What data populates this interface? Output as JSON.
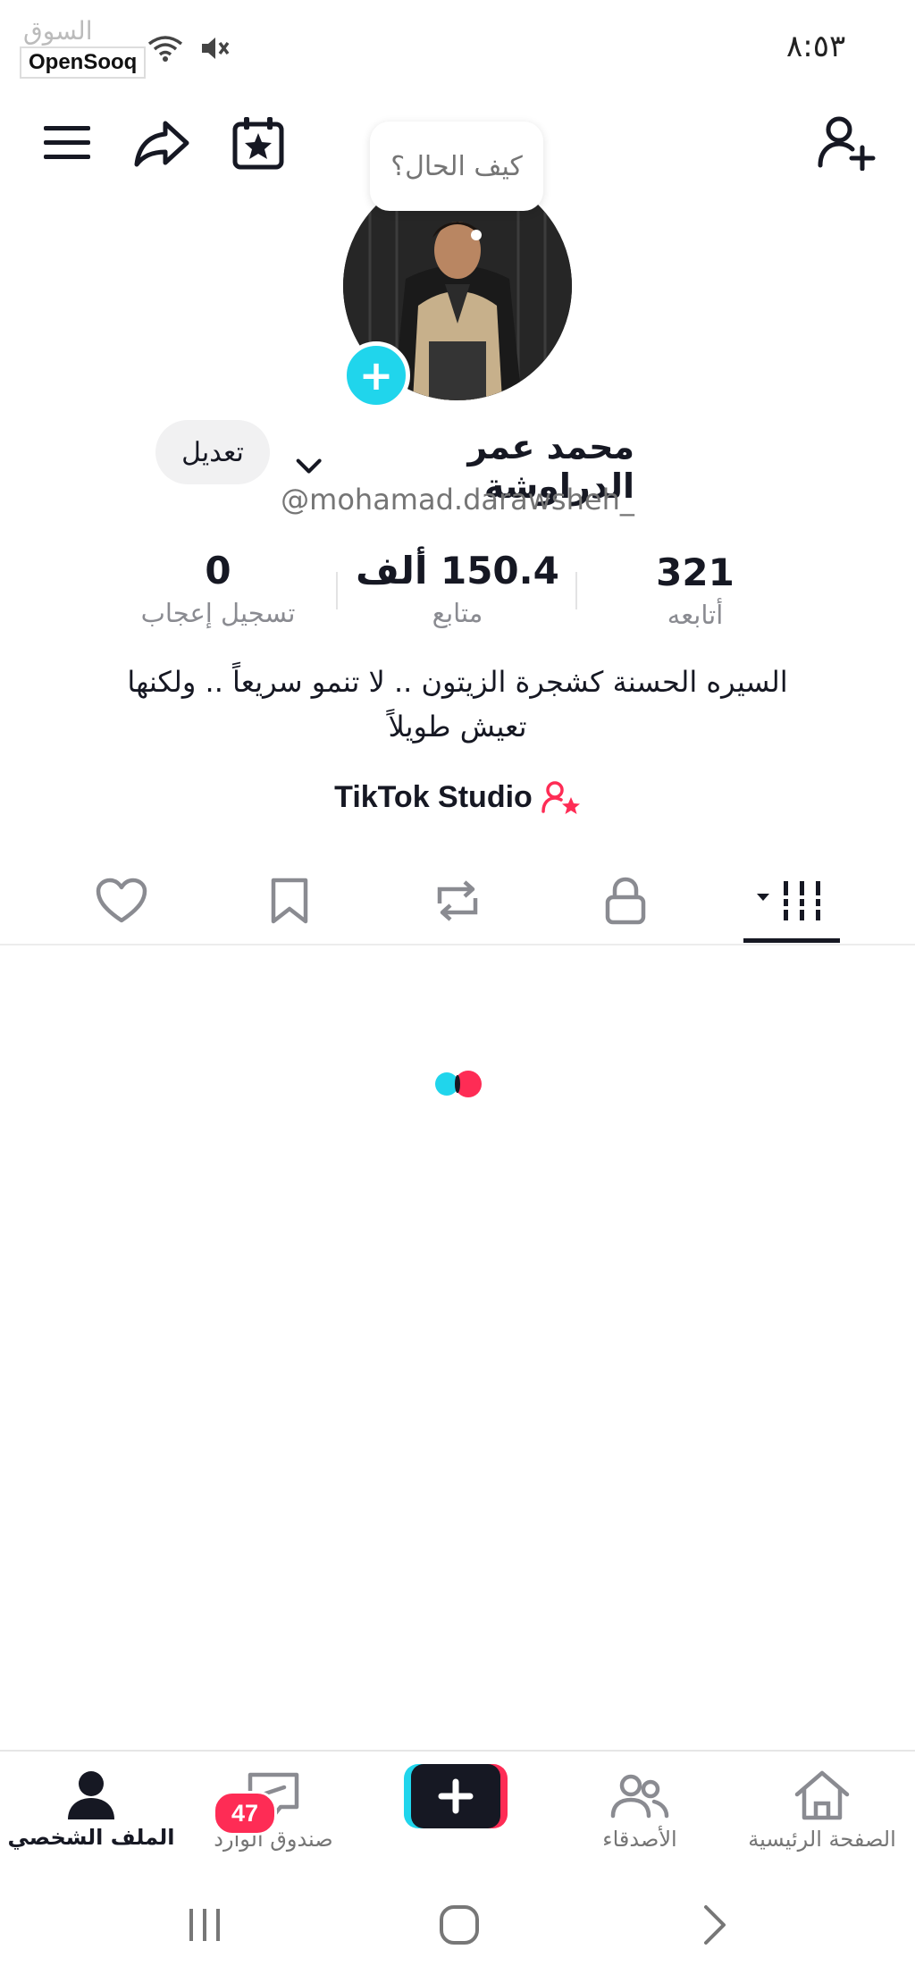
{
  "status_bar": {
    "time": "٨:٥٣",
    "watermark_arabic": "السوق المفتوح",
    "watermark_brand": "OpenSooq"
  },
  "header": {
    "bubble_text": "كيف الحال؟"
  },
  "profile": {
    "name": "محمد عمر الدراوشة",
    "username": "@mohamad.darawsheh_",
    "edit_label": "تعديل",
    "bio_line1": "السيره الحسنة كشجرة الزيتون .. لا تنمو سريعاً .. ولكنها",
    "bio_line2": "تعيش طويلاً",
    "studio_label": "TikTok Studio"
  },
  "stats": {
    "following_value": "321",
    "following_label": "أتابعه",
    "followers_value": "150.4 ألف",
    "followers_label": "متابع",
    "likes_value": "0",
    "likes_label": "تسجيل إعجاب"
  },
  "bottom_nav": {
    "home": "الصفحة الرئيسية",
    "friends": "الأصدقاء",
    "inbox": "صندوق الوارد",
    "inbox_badge": "47",
    "profile": "الملف الشخصي"
  },
  "colors": {
    "accent_cyan": "#20d5ec",
    "accent_red": "#fe2c55",
    "text_primary": "#161823",
    "text_secondary": "#8a8b91"
  }
}
